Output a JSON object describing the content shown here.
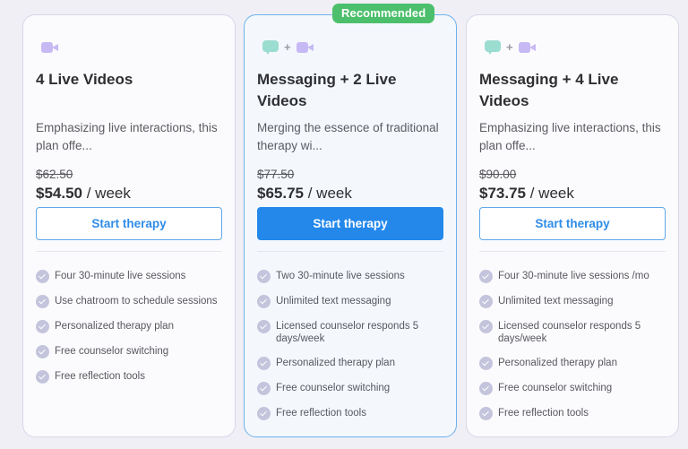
{
  "badge": {
    "label": "Recommended",
    "color": "#4cbf6c"
  },
  "plans": [
    {
      "icons": [
        "video-icon"
      ],
      "title": "4 Live Videos",
      "description": "Emphasizing live interactions, this plan offe...",
      "old_price": "$62.50",
      "price": "$54.50",
      "period": " / week",
      "cta_label": "Start therapy",
      "features": [
        "Four 30-minute live sessions",
        "Use chatroom to schedule sessions",
        "Personalized therapy plan",
        "Free counselor switching",
        "Free reflection tools"
      ]
    },
    {
      "icons": [
        "message-icon",
        "plus",
        "video-icon"
      ],
      "plus_label": "+",
      "title": "Messaging + 2 Live Videos",
      "description": "Merging the essence of traditional therapy wi...",
      "old_price": "$77.50",
      "price": "$65.75",
      "period": " / week",
      "cta_label": "Start therapy",
      "recommended": true,
      "features": [
        "Two 30-minute live sessions",
        "Unlimited text messaging",
        "Licensed counselor responds 5 days/week",
        "Personalized therapy plan",
        "Free counselor switching",
        "Free reflection tools"
      ]
    },
    {
      "icons": [
        "message-icon",
        "plus",
        "video-icon"
      ],
      "plus_label": "+",
      "title": "Messaging + 4 Live Videos",
      "description": "Emphasizing live interactions, this plan offe...",
      "old_price": "$90.00",
      "price": "$73.75",
      "period": " / week",
      "cta_label": "Start therapy",
      "features": [
        "Four 30-minute live sessions /mo",
        "Unlimited text messaging",
        "Licensed counselor responds 5 days/week",
        "Personalized therapy plan",
        "Free counselor switching",
        "Free reflection tools"
      ]
    }
  ],
  "colors": {
    "accent": "#2488eb",
    "message_icon": "#9bddd0",
    "video_icon": "#c7b9f4",
    "check_icon": "#c4c4dc"
  }
}
